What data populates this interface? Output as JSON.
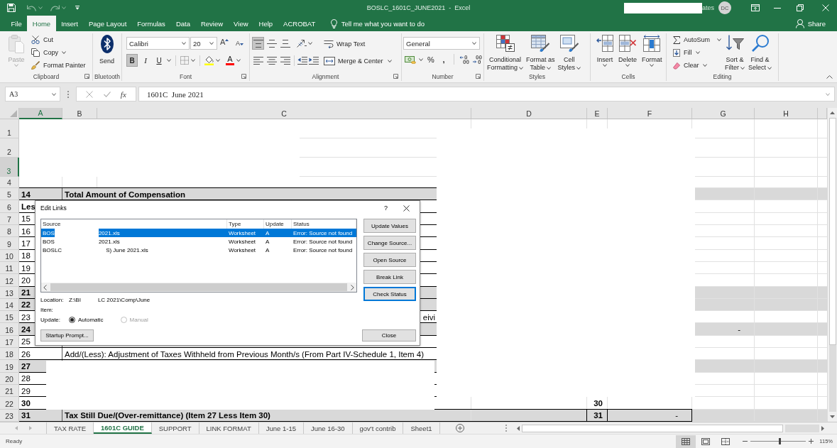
{
  "title_bar": {
    "title": "BOSLC_1601C_JUNE2021  -  Excel",
    "account_name": "ates",
    "avatar_initials": "DC"
  },
  "ribbon_tabs": [
    {
      "label": "File",
      "selected": false
    },
    {
      "label": "Home",
      "selected": true
    },
    {
      "label": "Insert",
      "selected": false
    },
    {
      "label": "Page Layout",
      "selected": false
    },
    {
      "label": "Formulas",
      "selected": false
    },
    {
      "label": "Data",
      "selected": false
    },
    {
      "label": "Review",
      "selected": false
    },
    {
      "label": "View",
      "selected": false
    },
    {
      "label": "Help",
      "selected": false
    },
    {
      "label": "ACROBAT",
      "selected": false
    }
  ],
  "tell_me": "Tell me what you want to do",
  "share": "Share",
  "ribbon": {
    "clipboard": {
      "label": "Clipboard",
      "paste": {
        "label": "Paste",
        "disabled": true
      },
      "cut": "Cut",
      "copy": "Copy",
      "format_painter": "Format Painter"
    },
    "bluetooth": {
      "label": "Bluetooth",
      "send": "Send"
    },
    "font": {
      "label": "Font",
      "font_name": "Calibri",
      "font_size": "20",
      "grow_glyph": "A",
      "shrink_glyph": "A",
      "styles": [
        {
          "kind": "bold",
          "glyph": "B",
          "on": true
        },
        {
          "kind": "italic",
          "glyph": "I",
          "on": false
        },
        {
          "kind": "underline",
          "glyph": "U",
          "on": false
        }
      ],
      "font_color_glyph": "A"
    },
    "alignment": {
      "label": "Alignment",
      "vertical": [
        {
          "kind": "top",
          "selected": true
        },
        {
          "kind": "middle",
          "selected": false
        },
        {
          "kind": "bottom",
          "selected": false
        }
      ],
      "horizontal": [
        {
          "kind": "left",
          "selected": false
        },
        {
          "kind": "center",
          "selected": false
        },
        {
          "kind": "right",
          "selected": false
        }
      ],
      "wrap_text": "Wrap Text",
      "merge": "Merge & Center"
    },
    "number": {
      "label": "Number",
      "format": "General",
      "percent_glyph": "%",
      "comma_glyph": ","
    },
    "styles": {
      "label": "Styles",
      "buttons": [
        {
          "kind": "conditional-formatting",
          "lines": [
            "Conditional",
            "Formatting"
          ]
        },
        {
          "kind": "format-as-table",
          "lines": [
            "Format as",
            "Table"
          ]
        },
        {
          "kind": "cell-styles",
          "lines": [
            "Cell",
            "Styles"
          ]
        }
      ]
    },
    "cells": {
      "label": "Cells",
      "buttons": [
        {
          "kind": "insert",
          "label": "Insert"
        },
        {
          "kind": "delete",
          "label": "Delete"
        },
        {
          "kind": "format",
          "label": "Format"
        }
      ]
    },
    "editing": {
      "label": "Editing",
      "autosum": "AutoSum",
      "fill": "Fill",
      "clear": "Clear",
      "sort_filter": [
        "Sort &",
        "Filter"
      ],
      "find_select": [
        "Find &",
        "Select"
      ]
    }
  },
  "formula_bar": {
    "name_box": "A3",
    "function_glyph": "fx",
    "value": "1601C  June 2021"
  },
  "sheet": {
    "columns": [
      {
        "label": "A",
        "selected": true
      },
      {
        "label": "B",
        "selected": false
      },
      {
        "label": "C",
        "selected": false
      },
      {
        "label": "D",
        "selected": false
      },
      {
        "label": "E",
        "selected": false
      },
      {
        "label": "F",
        "selected": false
      },
      {
        "label": "G",
        "selected": false
      },
      {
        "label": "H",
        "selected": false
      }
    ],
    "rows": [
      {
        "number": "1",
        "selected": false,
        "shaded": false
      },
      {
        "number": "2",
        "selected": false,
        "shaded": false
      },
      {
        "number": "3",
        "selected": true,
        "shaded": false
      },
      {
        "number": "4",
        "selected": false,
        "shaded": false
      },
      {
        "number": "5",
        "selected": false,
        "shaded": true,
        "cells": {
          "a": {
            "text": "14",
            "bold": true
          },
          "b": {
            "text": "Total Amount of Compensation",
            "bold": true
          }
        }
      },
      {
        "number": "6",
        "selected": false,
        "shaded": false,
        "cells": {
          "a": {
            "text": "Les",
            "bold": true
          }
        }
      },
      {
        "number": "7",
        "selected": false,
        "shaded": false,
        "cells": {
          "a": {
            "text": "15",
            "bold": false
          }
        }
      },
      {
        "number": "8",
        "selected": false,
        "shaded": false,
        "cells": {
          "a": {
            "text": "16",
            "bold": false
          }
        }
      },
      {
        "number": "9",
        "selected": false,
        "shaded": false,
        "cells": {
          "a": {
            "text": "17",
            "bold": false
          }
        }
      },
      {
        "number": "10",
        "selected": false,
        "shaded": false,
        "cells": {
          "a": {
            "text": "18",
            "bold": false
          }
        }
      },
      {
        "number": "11",
        "selected": false,
        "shaded": false,
        "cells": {
          "a": {
            "text": "19",
            "bold": false
          }
        }
      },
      {
        "number": "12",
        "selected": false,
        "shaded": false,
        "cells": {
          "a": {
            "text": "20",
            "bold": false
          }
        }
      },
      {
        "number": "13",
        "selected": false,
        "shaded": true,
        "cells": {
          "a": {
            "text": "21",
            "bold": true
          }
        }
      },
      {
        "number": "14",
        "selected": false,
        "shaded": true,
        "cells": {
          "a": {
            "text": "22",
            "bold": true
          }
        }
      },
      {
        "number": "15",
        "selected": false,
        "shaded": false,
        "cells": {
          "a": {
            "text": "23",
            "bold": false
          },
          "c": {
            "text": "eivi",
            "bold": false
          }
        }
      },
      {
        "number": "16",
        "selected": false,
        "shaded": true,
        "cells": {
          "a": {
            "text": "24",
            "bold": true
          },
          "g": {
            "text": "-",
            "bold": false
          }
        }
      },
      {
        "number": "17",
        "selected": false,
        "shaded": false,
        "cells": {
          "a": {
            "text": "25",
            "bold": false
          }
        }
      },
      {
        "number": "18",
        "selected": false,
        "shaded": false,
        "cells": {
          "a": {
            "text": "26",
            "bold": false
          },
          "b": {
            "text": "Add/(Less): Adjustment of Taxes Withheld from Previous Month/s (From Part IV-Schedule 1, Item 4)",
            "bold": false
          }
        }
      },
      {
        "number": "19",
        "selected": false,
        "shaded": true,
        "cells": {
          "a": {
            "text": "27",
            "bold": true
          }
        }
      },
      {
        "number": "20",
        "selected": false,
        "shaded": false,
        "cells": {
          "a": {
            "text": "28",
            "bold": false
          }
        }
      },
      {
        "number": "21",
        "selected": false,
        "shaded": false,
        "cells": {
          "a": {
            "text": "29",
            "bold": false
          }
        }
      },
      {
        "number": "22",
        "selected": false,
        "shaded": false,
        "cells": {
          "a": {
            "text": "30",
            "bold": true
          },
          "e": {
            "text": "30",
            "bold": true
          }
        }
      },
      {
        "number": "23",
        "selected": false,
        "shaded": true,
        "cells": {
          "a": {
            "text": "31",
            "bold": true
          },
          "b": {
            "text": "Tax Still Due/(Over-remittance) (Item 27 Less Item 30)",
            "bold": true
          },
          "e": {
            "text": "31",
            "bold": true
          },
          "f": {
            "text": "-",
            "bold": false
          }
        }
      }
    ]
  },
  "dialog": {
    "title": "Edit Links",
    "help_glyph": "?",
    "columns": [
      "Source",
      "Type",
      "Update",
      "Status"
    ],
    "links": [
      {
        "source_start": "BOS",
        "source_end": "2021.xls",
        "type": "Worksheet",
        "update": "A",
        "status": "Error: Source not found",
        "selected": true
      },
      {
        "source_start": "BOS",
        "source_end": "2021.xls",
        "type": "Worksheet",
        "update": "A",
        "status": "Error: Source not found",
        "selected": false
      },
      {
        "source_start": "BOSLC",
        "source_end": "S) June 2021.xls",
        "type": "Worksheet",
        "update": "A",
        "status": "Error: Source not found",
        "selected": false
      }
    ],
    "buttons": [
      {
        "label": "Update Values",
        "focused": false
      },
      {
        "label": "Change Source...",
        "focused": false
      },
      {
        "label": "Open Source",
        "focused": false
      },
      {
        "label": "Break Link",
        "focused": false
      },
      {
        "label": "Check Status",
        "focused": true
      }
    ],
    "location_label": "Location:",
    "location_start": "Z:\\BI",
    "location_end": "LC 2021\\Comp\\June",
    "item_label": "Item:",
    "update_label": "Update:",
    "update_options": [
      {
        "label": "Automatic",
        "selected": true,
        "disabled": false
      },
      {
        "label": "Manual",
        "selected": false,
        "disabled": true
      }
    ],
    "startup_button": "Startup Prompt...",
    "close_button": "Close"
  },
  "sheet_tabs": [
    {
      "label": "TAX RATE",
      "selected": false
    },
    {
      "label": "1601C GUIDE",
      "selected": true
    },
    {
      "label": "SUPPORT",
      "selected": false
    },
    {
      "label": "LINK FORMAT",
      "selected": false
    },
    {
      "label": "June 1-15",
      "selected": false
    },
    {
      "label": "June 16-30",
      "selected": false
    },
    {
      "label": "gov't contrib",
      "selected": false
    },
    {
      "label": "Sheet1",
      "selected": false
    }
  ],
  "status_bar": {
    "status": "Ready",
    "views": [
      {
        "kind": "normal",
        "selected": true
      },
      {
        "kind": "page-layout",
        "selected": false
      },
      {
        "kind": "page-break",
        "selected": false
      }
    ],
    "zoom": {
      "level": 0.53,
      "reading": "115%"
    }
  }
}
